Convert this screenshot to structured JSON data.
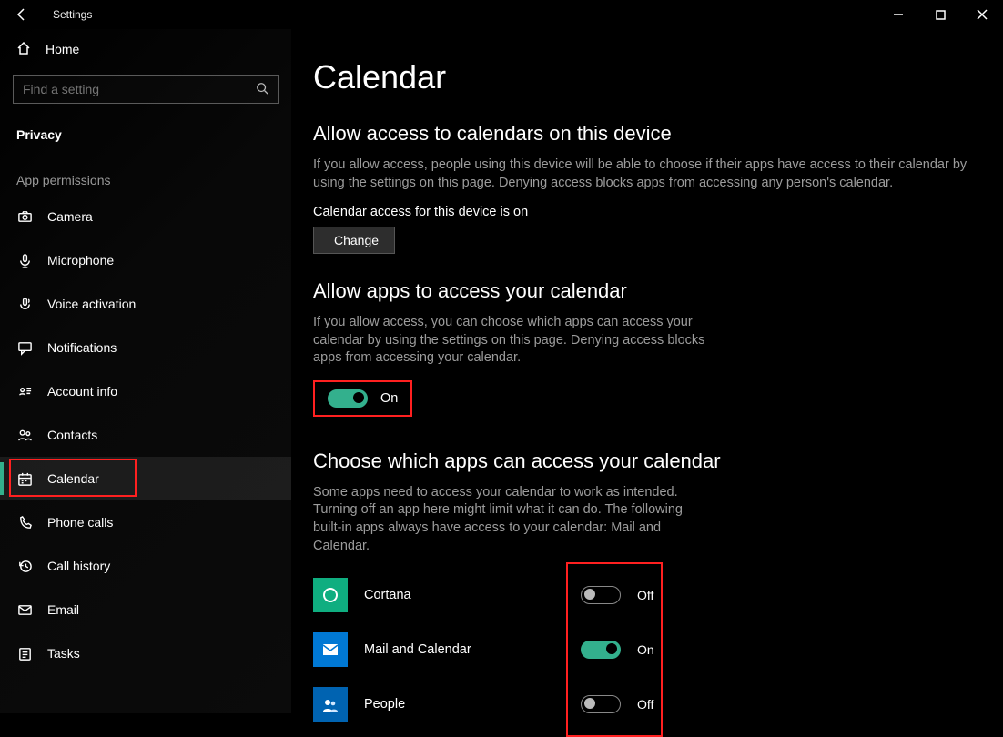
{
  "window": {
    "title": "Settings"
  },
  "sidebar": {
    "home": "Home",
    "search_placeholder": "Find a setting",
    "category": "Privacy",
    "group": "App permissions",
    "items": [
      {
        "label": "Camera",
        "icon": "camera-icon"
      },
      {
        "label": "Microphone",
        "icon": "microphone-icon"
      },
      {
        "label": "Voice activation",
        "icon": "voice-icon"
      },
      {
        "label": "Notifications",
        "icon": "chat-icon"
      },
      {
        "label": "Account info",
        "icon": "id-icon"
      },
      {
        "label": "Contacts",
        "icon": "people-icon"
      },
      {
        "label": "Calendar",
        "icon": "calendar-icon",
        "active": true
      },
      {
        "label": "Phone calls",
        "icon": "phone-icon"
      },
      {
        "label": "Call history",
        "icon": "history-icon"
      },
      {
        "label": "Email",
        "icon": "mail-icon"
      },
      {
        "label": "Tasks",
        "icon": "tasks-icon"
      }
    ]
  },
  "page": {
    "title": "Calendar",
    "s1": {
      "heading": "Allow access to calendars on this device",
      "desc": "If you allow access, people using this device will be able to choose if their apps have access to their calendar by using the settings on this page. Denying access blocks apps from accessing any person's calendar.",
      "status": "Calendar access for this device is on",
      "button": "Change"
    },
    "s2": {
      "heading": "Allow apps to access your calendar",
      "desc": "If you allow access, you can choose which apps can access your calendar by using the settings on this page. Denying access blocks apps from accessing your calendar.",
      "toggle_state": "On",
      "toggle_on": true
    },
    "s3": {
      "heading": "Choose which apps can access your calendar",
      "desc": "Some apps need to access your calendar to work as intended. Turning off an app here might limit what it can do. The following built-in apps always have access to your calendar: Mail and Calendar.",
      "apps": [
        {
          "name": "Cortana",
          "state": "Off",
          "on": false,
          "icon_bg": "#0fae80"
        },
        {
          "name": "Mail and Calendar",
          "state": "On",
          "on": true,
          "icon_bg": "#0078d4"
        },
        {
          "name": "People",
          "state": "Off",
          "on": false,
          "icon_bg": "#0063b1"
        }
      ]
    }
  }
}
